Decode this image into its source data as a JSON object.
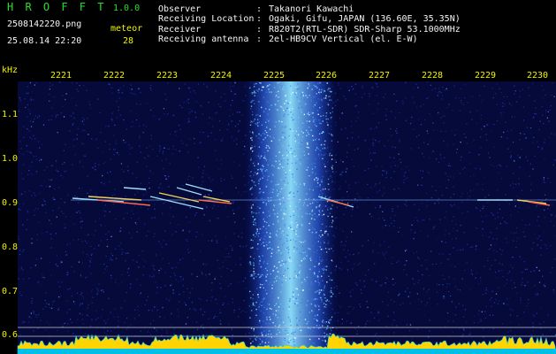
{
  "header": {
    "app_title": "H R O F F T",
    "version": "1.0.0",
    "filename": "2508142220.png",
    "datetime": "25.08.14 22:20",
    "detection_label": "meteor",
    "detection_count": "28",
    "info": [
      {
        "key": "Observer",
        "sep": ":",
        "value": "Takanori Kawachi"
      },
      {
        "key": "Receiving Location",
        "sep": ":",
        "value": "Ogaki, Gifu, JAPAN (136.60E, 35.35N)"
      },
      {
        "key": "Receiver",
        "sep": ":",
        "value": "R820T2(RTL-SDR) SDR-Sharp 53.1000MHz"
      },
      {
        "key": "Receiving antenna",
        "sep": ":",
        "value": "2el-HB9CV Vertical (el. E-W)"
      }
    ]
  },
  "axes": {
    "y_unit": "kHz",
    "x_ticks": [
      "2221",
      "2222",
      "2223",
      "2224",
      "2225",
      "2226",
      "2227",
      "2228",
      "2229",
      "2230"
    ],
    "y_ticks": [
      "1.1",
      "1.0",
      "0.9",
      "0.8",
      "0.7",
      "0.6"
    ]
  },
  "colors": {
    "header_green": "#25e02a",
    "header_white": "#f4f4f4",
    "label_yellow": "#f2f200",
    "noise_blue": "#1b2f9a",
    "band_cyan": "#6fd8ff",
    "floor_yellow": "#ffd400"
  }
}
